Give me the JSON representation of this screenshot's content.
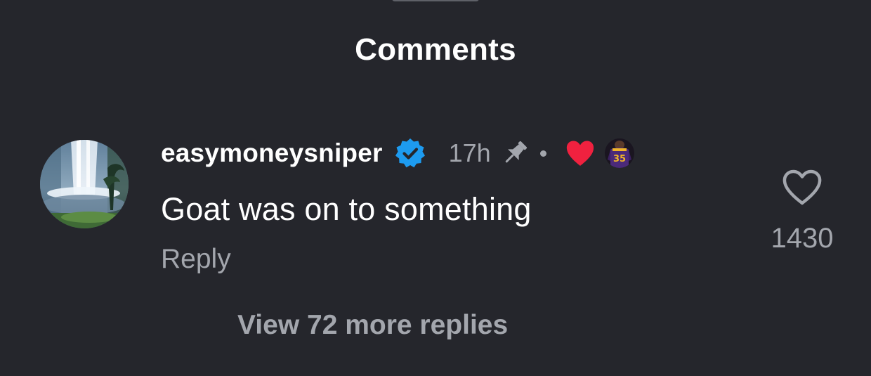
{
  "sheet": {
    "title": "Comments"
  },
  "comment": {
    "username": "easymoneysniper",
    "timestamp": "17h",
    "text": "Goat was on to something",
    "reply_label": "Reply",
    "like_count": "1430",
    "verified": true,
    "pinned": true,
    "liked_by_creator": true,
    "creator_avatar_jersey_number": "35",
    "icons": {
      "verified": "verified-badge-icon",
      "pin": "pin-icon",
      "creator_heart": "heart-filled-icon",
      "like": "heart-outline-icon"
    },
    "colors": {
      "verified": "#1d9bf0",
      "creator_heart": "#f0213f",
      "muted_text": "#a3a6ad",
      "background": "#25262c"
    }
  },
  "replies": {
    "view_more_label": "View 72 more replies"
  }
}
